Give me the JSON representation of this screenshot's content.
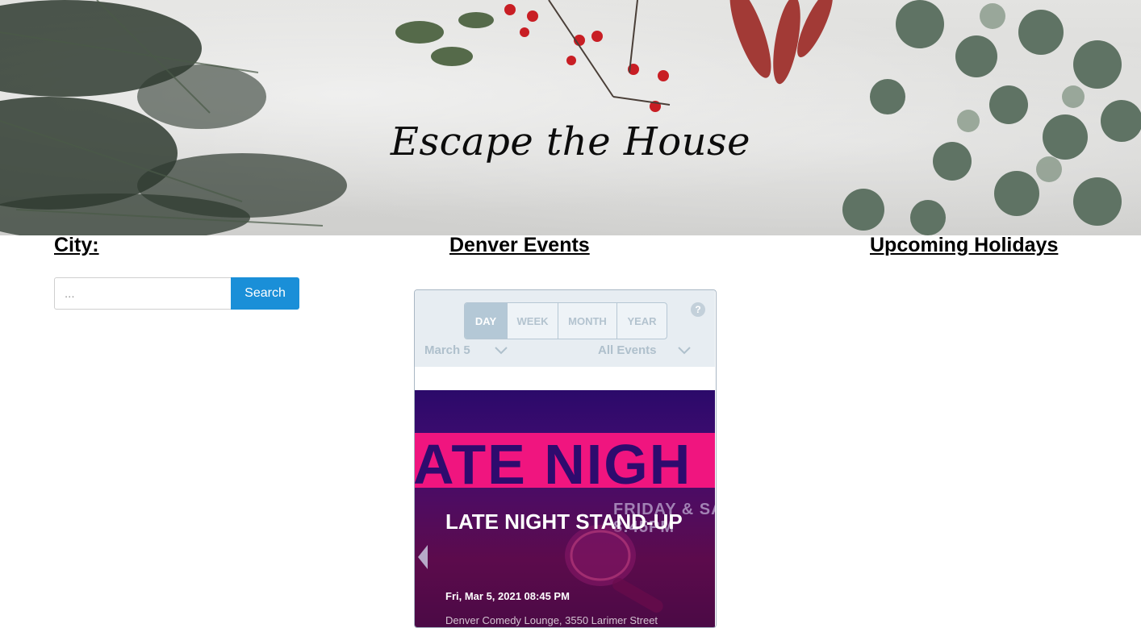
{
  "header": {
    "site_title": "Escape the House"
  },
  "sections": {
    "city_heading": "City:",
    "events_heading": "Denver Events",
    "holidays_heading": "Upcoming Holidays"
  },
  "search": {
    "placeholder": "...",
    "value": "",
    "button_label": "Search"
  },
  "event_widget": {
    "views": [
      "DAY",
      "WEEK",
      "MONTH",
      "YEAR"
    ],
    "active_view": "DAY",
    "help_label": "?",
    "date_filter": "March 5",
    "event_filter": "All Events",
    "event": {
      "poster_heading": "ATE NIGH",
      "poster_days_line1": "FRIDAY & SA",
      "poster_days_line2": "8:45PM",
      "title": "LATE NIGHT STAND-UP",
      "datetime": "Fri, Mar 5, 2021 08:45 PM",
      "venue": "Denver Comedy Lounge, 3550 Larimer Street"
    }
  },
  "colors": {
    "search_button": "#1a8fd8",
    "poster_band": "#f0157f",
    "widget_header": "#e7edf2"
  }
}
